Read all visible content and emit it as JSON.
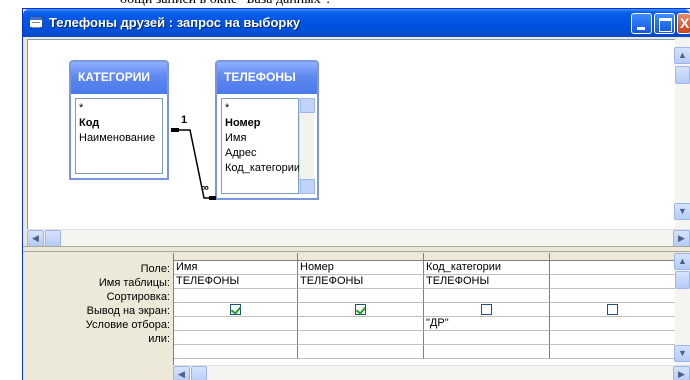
{
  "page_caption": "общи записи в окне \"База данных\".",
  "window": {
    "title": "Телефоны друзей : запрос на выборку",
    "close_glyph": "X"
  },
  "tables": [
    {
      "name": "КАТЕГОРИИ",
      "fields": [
        "*",
        "Код",
        "Наименование"
      ],
      "key_field": "Код"
    },
    {
      "name": "ТЕЛЕФОНЫ",
      "fields": [
        "*",
        "Номер",
        "Имя",
        "Адрес",
        "Код_категории"
      ],
      "key_field": "Номер"
    }
  ],
  "relationship": {
    "one_side": "1",
    "many_side": "∞"
  },
  "grid": {
    "row_labels": [
      "Поле:",
      "Имя таблицы:",
      "Сортировка:",
      "Вывод на экран:",
      "Условие отбора:",
      "или:"
    ],
    "columns": [
      {
        "field": "Имя",
        "table": "ТЕЛЕФОНЫ",
        "sort": "",
        "show": true,
        "criteria": "",
        "or": ""
      },
      {
        "field": "Номер",
        "table": "ТЕЛЕФОНЫ",
        "sort": "",
        "show": true,
        "criteria": "",
        "or": ""
      },
      {
        "field": "Код_категории",
        "table": "ТЕЛЕФОНЫ",
        "sort": "",
        "show": false,
        "criteria": "\"ДР\"",
        "or": ""
      },
      {
        "field": "",
        "table": "",
        "sort": "",
        "show": false,
        "criteria": "",
        "or": ""
      }
    ]
  },
  "colors": {
    "titlebar": "#0054e3",
    "table_header": "#5f89f0",
    "window_bg": "#ece9d8",
    "checkbox_mark": "#21a121"
  },
  "icons": {
    "window_icon": "query-window-icon",
    "minimize": "minimize-icon",
    "maximize": "maximize-icon",
    "close": "close-icon",
    "scroll_left": "arrow-left-icon",
    "scroll_right": "arrow-right-icon",
    "scroll_up": "arrow-up-icon",
    "scroll_down": "arrow-down-icon"
  }
}
